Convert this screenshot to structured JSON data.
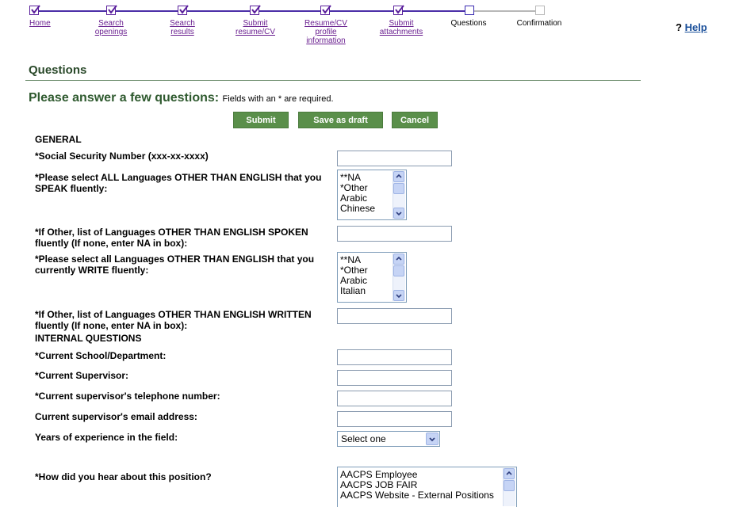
{
  "progress": {
    "steps": [
      {
        "label": "Home",
        "state": "done"
      },
      {
        "label": "Search\nopenings",
        "state": "done"
      },
      {
        "label": "Search\nresults",
        "state": "done"
      },
      {
        "label": "Submit\nresume/CV",
        "state": "done"
      },
      {
        "label": "Resume/CV\nprofile\ninformation",
        "state": "done"
      },
      {
        "label": "Submit\nattachments",
        "state": "done"
      },
      {
        "label": "Questions",
        "state": "current"
      },
      {
        "label": "Confirmation",
        "state": "future"
      }
    ]
  },
  "help": {
    "symbol": "?",
    "label": "Help"
  },
  "section_title": "Questions",
  "prompt": {
    "main": "Please answer a few questions:",
    "note": "Fields with an * are required."
  },
  "buttons": {
    "submit": "Submit",
    "save_draft": "Save as draft",
    "cancel": "Cancel"
  },
  "form": {
    "general_heading": "GENERAL",
    "ssn_label": "*Social Security Number (xxx-xx-xxxx)",
    "speak_label": "*Please select ALL Languages OTHER THAN ENGLISH that you SPEAK fluently:",
    "speak_options": [
      "**NA",
      "*Other",
      "Arabic",
      "Chinese"
    ],
    "other_spoken_label": "*If Other, list of Languages OTHER THAN ENGLISH SPOKEN fluently (If none, enter NA in box):",
    "write_label": "*Please select all Languages OTHER THAN ENGLISH that you currently WRITE fluently:",
    "write_options": [
      "**NA",
      "*Other",
      "Arabic",
      "Italian"
    ],
    "other_written_label": "*If Other, list of Languages OTHER THAN ENGLISH WRITTEN fluently (If none, enter NA in box):",
    "internal_heading": "INTERNAL QUESTIONS",
    "school_label": "*Current School/Department:",
    "supervisor_label": "*Current Supervisor:",
    "sup_phone_label": "*Current supervisor's telephone number:",
    "sup_email_label": "Current supervisor's email address:",
    "years_label": "Years of experience in the field:",
    "years_value": "Select one",
    "hear_label": "*How did you hear about this position?",
    "hear_options": [
      "AACPS Employee",
      "AACPS JOB FAIR",
      "AACPS Website - External Positions"
    ]
  },
  "colors": {
    "step_line": "#4b2fa8",
    "step_future": "#b8b8b8",
    "accent_green": "#5a8f4a",
    "title_green": "#2f5a2f",
    "link_purple": "#6a2090"
  }
}
